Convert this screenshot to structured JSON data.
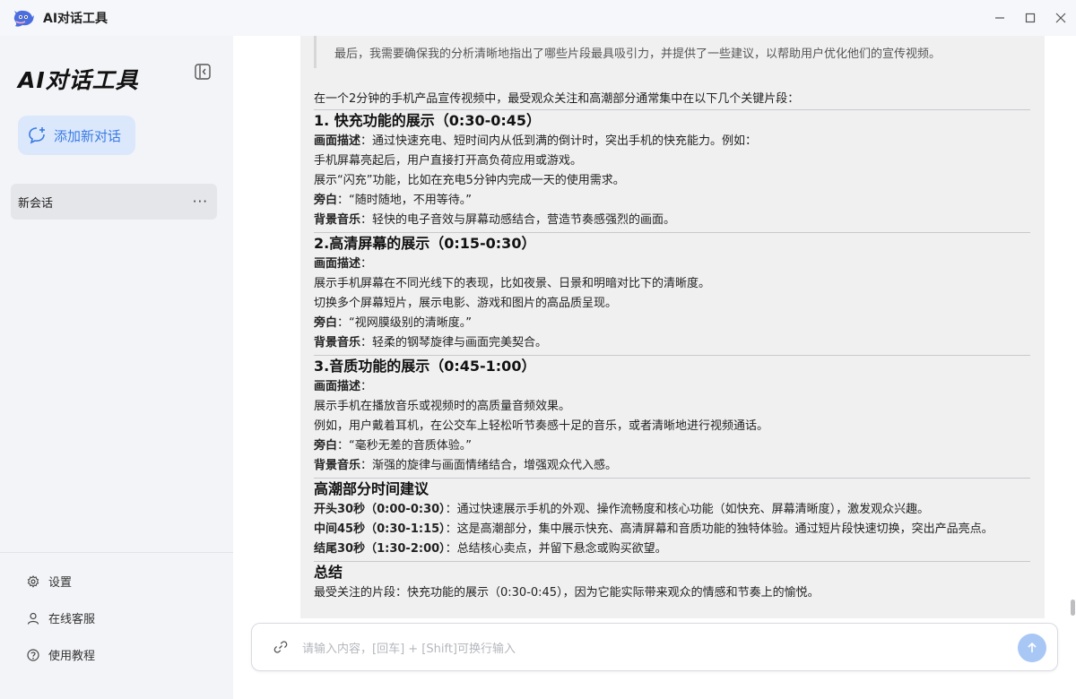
{
  "app": {
    "title": "AI对话工具"
  },
  "window_controls": [
    "minimize-icon",
    "maximize-icon",
    "close-icon"
  ],
  "sidebar": {
    "title": "AI对话工具",
    "new_chat_label": "添加新对话",
    "chats": [
      {
        "label": "新会话",
        "more": "···"
      }
    ],
    "bottom_links": [
      {
        "label": "设置",
        "icon": "gear-icon"
      },
      {
        "label": "在线客服",
        "icon": "user-icon"
      },
      {
        "label": "使用教程",
        "icon": "help-icon"
      }
    ]
  },
  "message": {
    "quote_cut": "",
    "quote": "最后，我需要确保我的分析清晰地指出了哪些片段最具吸引力，并提供了一些建议，以帮助用户优化他们的宣传视频。",
    "intro": "在一个2分钟的手机产品宣传视频中，最受观众关注和高潮部分通常集中在以下几个关键片段：",
    "sections": [
      {
        "heading": "1. 快充功能的展示（0:30-0:45）",
        "desc_label": "画面描述",
        "desc_text": "：通过快速充电、短时间内从低到满的倒计时，突出手机的快充能力。例如：",
        "lines": [
          "手机屏幕亮起后，用户直接打开高负荷应用或游戏。",
          "展示“闪充”功能，比如在充电5分钟内完成一天的使用需求。"
        ],
        "narration_label": "旁白",
        "narration_text": "：“随时随地，不用等待。”",
        "music_label": "背景音乐",
        "music_text": "：轻快的电子音效与屏幕动感结合，营造节奏感强烈的画面。"
      },
      {
        "heading": "2.高清屏幕的展示（0:15-0:30）",
        "desc_label": "画面描述",
        "desc_text": "：",
        "lines": [
          "展示手机屏幕在不同光线下的表现，比如夜景、日景和明暗对比下的清晰度。",
          "切换多个屏幕短片，展示电影、游戏和图片的高品质呈现。"
        ],
        "narration_label": "旁白",
        "narration_text": "：“视网膜级别的清晰度。”",
        "music_label": "背景音乐",
        "music_text": "：轻柔的钢琴旋律与画面完美契合。"
      },
      {
        "heading": "3.音质功能的展示（0:45-1:00）",
        "desc_label": "画面描述",
        "desc_text": "：",
        "lines": [
          "展示手机在播放音乐或视频时的高质量音频效果。",
          "例如，用户戴着耳机，在公交车上轻松听节奏感十足的音乐，或者清晰地进行视频通话。"
        ],
        "narration_label": "旁白",
        "narration_text": "：“毫秒无差的音质体验。”",
        "music_label": "背景音乐",
        "music_text": "：渐强的旋律与画面情绪结合，增强观众代入感。"
      }
    ],
    "climax": {
      "heading": "高潮部分时间建议",
      "items": [
        {
          "label": "开头30秒（0:00-0:30）",
          "text": "：通过快速展示手机的外观、操作流畅度和核心功能（如快充、屏幕清晰度），激发观众兴趣。"
        },
        {
          "label": "中间45秒（0:30-1:15）",
          "text": "：这是高潮部分，集中展示快充、高清屏幕和音质功能的独特体验。通过短片段快速切换，突出产品亮点。"
        },
        {
          "label": "结尾30秒（1:30-2:00）",
          "text": "：总结核心卖点，并留下悬念或购买欲望。"
        }
      ]
    },
    "summary": {
      "heading": "总结",
      "cut_line": "最受关注的片段：快充功能的展示（0:30-0:45），因为它能实际带来观众的情感和节奏上的愉悦。"
    }
  },
  "input": {
    "placeholder": "请输入内容，[回车] + [Shift]可换行输入"
  },
  "colors": {
    "accent": "#3a7be3",
    "new_chat_bg": "#dbe8fc",
    "send_btn": "#a9c7f5"
  }
}
